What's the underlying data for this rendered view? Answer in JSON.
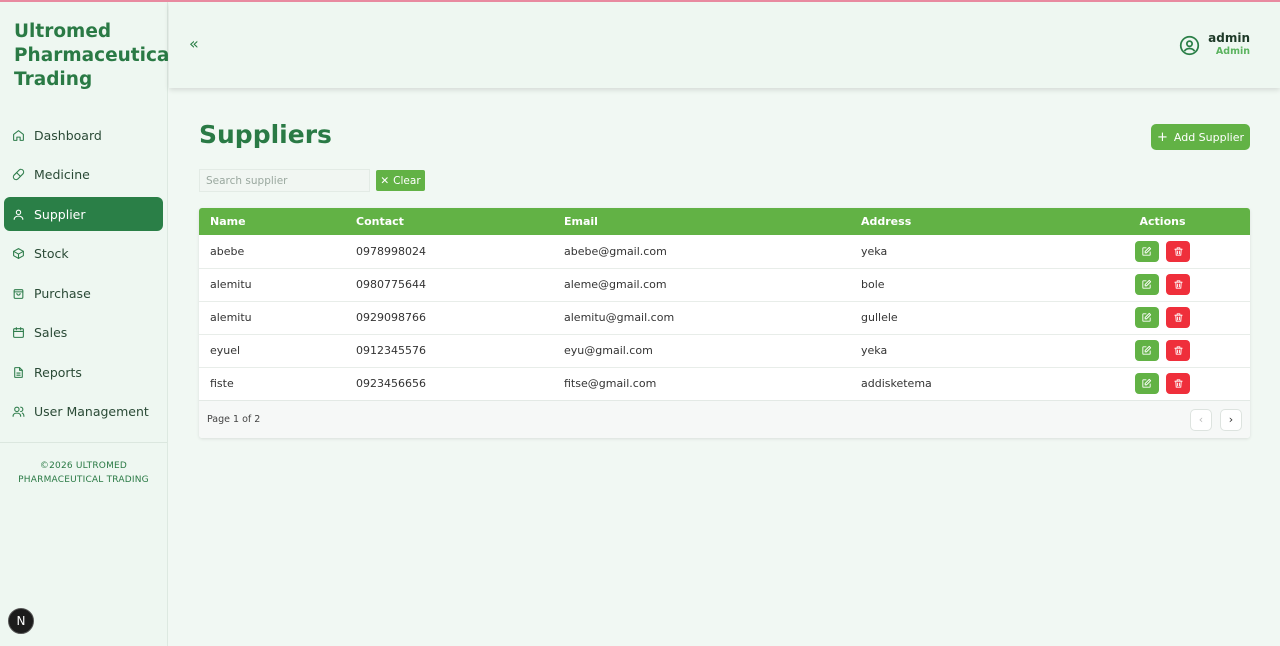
{
  "brand": {
    "line1": "Ultromed",
    "line2": "Pharmaceutical",
    "line3": "Trading"
  },
  "sidebar": {
    "items": [
      {
        "label": "Dashboard",
        "icon": "home-icon"
      },
      {
        "label": "Medicine",
        "icon": "pill-icon"
      },
      {
        "label": "Supplier",
        "icon": "user-icon",
        "active": true
      },
      {
        "label": "Stock",
        "icon": "box-icon"
      },
      {
        "label": "Purchase",
        "icon": "shopping-bag-icon"
      },
      {
        "label": "Sales",
        "icon": "calendar-icon"
      },
      {
        "label": "Reports",
        "icon": "file-text-icon"
      },
      {
        "label": "User Management",
        "icon": "users-icon"
      }
    ],
    "footer_line1": "©2026 ULTROMED",
    "footer_line2": "PHARMACEUTICAL TRADING",
    "dev_badge": "N"
  },
  "header": {
    "collapse_icon": "«",
    "user_name": "admin",
    "user_role": "Admin"
  },
  "main": {
    "title": "Suppliers",
    "add_button": "Add Supplier",
    "search_placeholder": "Search supplier",
    "clear_button": "Clear"
  },
  "table": {
    "headers": {
      "name": "Name",
      "contact": "Contact",
      "email": "Email",
      "address": "Address",
      "actions": "Actions"
    },
    "rows": [
      {
        "name": "abebe",
        "contact": "0978998024",
        "email": "abebe@gmail.com",
        "address": "yeka"
      },
      {
        "name": "alemitu",
        "contact": "0980775644",
        "email": "aleme@gmail.com",
        "address": "bole"
      },
      {
        "name": "alemitu",
        "contact": "0929098766",
        "email": "alemitu@gmail.com",
        "address": "gullele"
      },
      {
        "name": "eyuel",
        "contact": "0912345576",
        "email": "eyu@gmail.com",
        "address": "yeka"
      },
      {
        "name": "fiste",
        "contact": "0923456656",
        "email": "fitse@gmail.com",
        "address": "addisketema"
      }
    ],
    "page_info": "Page 1 of 2"
  },
  "colors": {
    "primary_dark": "#2a7f47",
    "primary": "#62b245",
    "danger": "#ef2f3b",
    "background": "#f1f8f3"
  }
}
